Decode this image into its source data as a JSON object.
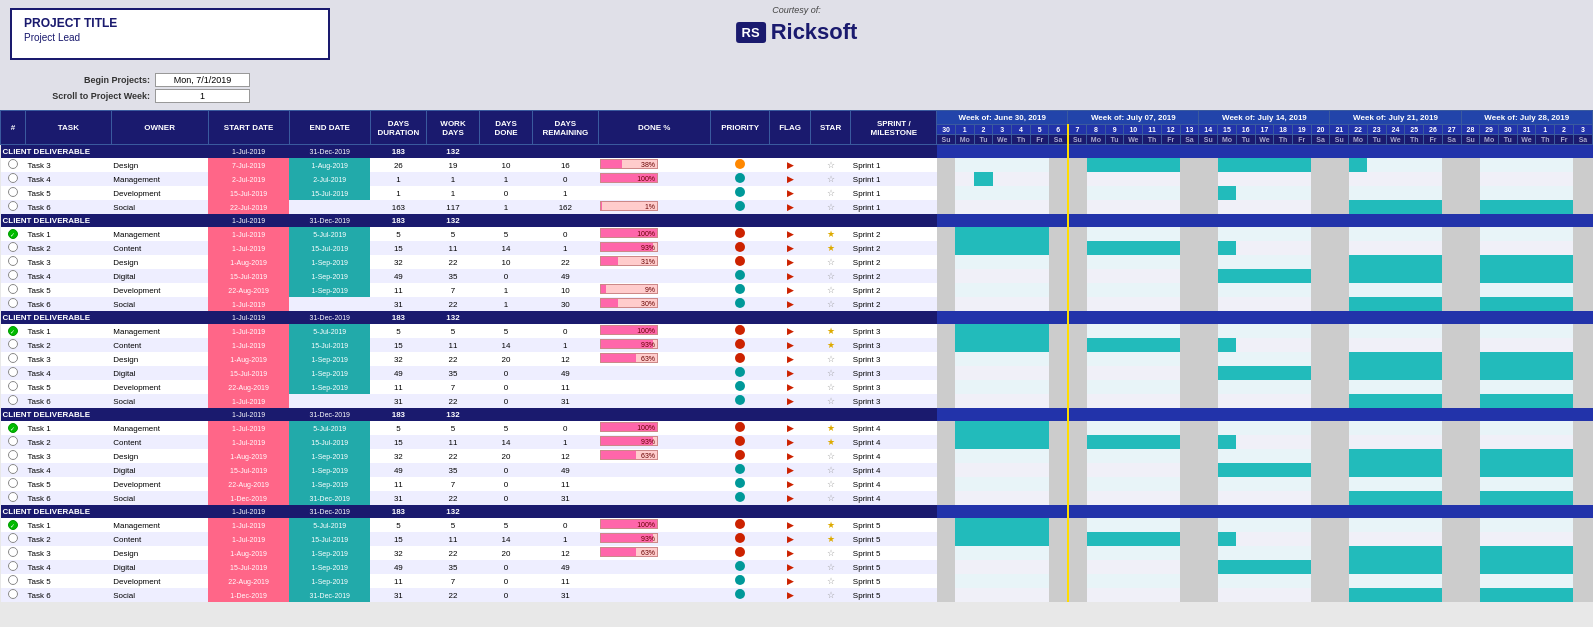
{
  "header": {
    "project_title": "PROJECT TITLE",
    "project_lead": "Project Lead",
    "courtesy_label": "Courtesy of:",
    "rs_logo": "RS",
    "company_name": "Ricksoft"
  },
  "controls": {
    "begin_label": "Begin Projects:",
    "begin_value": "Mon, 7/1/2019",
    "scroll_label": "Scroll to Project Week:",
    "scroll_value": "1"
  },
  "columns": {
    "status": "#",
    "task": "TASK",
    "owner": "OWNER",
    "start": "START DATE",
    "end": "END DATE",
    "duration": "DAYS DURATION",
    "work_days": "WORK DAYS",
    "days_done": "DAYS DONE",
    "days_remain": "DAYS REMAINING",
    "done_pct": "DONE %",
    "priority": "PRIORITY",
    "flag": "FLAG",
    "star": "STAR",
    "sprint": "SPRINT / MILESTONE"
  },
  "weeks": [
    "Week of: June 30, 2019",
    "Week of: July 07, 2019",
    "Week of: July 14, 2019",
    "Week of: July 21, 2019",
    "Week of: July 28, 2019"
  ],
  "sprints": [
    {
      "deliverable": {
        "start": "1-Jul-2019",
        "end": "31-Dec-2019",
        "duration": 183,
        "work_days": 132
      },
      "tasks": [
        {
          "status": "empty",
          "name": "Task 3",
          "owner": "Design",
          "start": "7-Jul-2019",
          "end": "1-Aug-2019",
          "dur": 26,
          "work": 19,
          "done": 10,
          "remain": 16,
          "pct": 38,
          "priority": "orange",
          "flag": true,
          "star": false,
          "sprint": "Sprint 1"
        },
        {
          "status": "empty",
          "name": "Task 4",
          "owner": "Management",
          "start": "2-Jul-2019",
          "end": "2-Jul-2019",
          "dur": 1,
          "work": 1,
          "done": 1,
          "remain": 0,
          "pct": 100,
          "priority": "teal",
          "flag": true,
          "star": false,
          "sprint": "Sprint 1"
        },
        {
          "status": "empty",
          "name": "Task 5",
          "owner": "Development",
          "start": "15-Jul-2019",
          "end": "15-Jul-2019",
          "dur": 1,
          "work": 1,
          "done": 0,
          "remain": 1,
          "pct": 0,
          "priority": "teal",
          "flag": true,
          "star": false,
          "sprint": "Sprint 1"
        },
        {
          "status": "empty",
          "name": "Task 6",
          "owner": "Social",
          "start": "22-Jul-2019",
          "end": "",
          "dur": 163,
          "work": 117,
          "done": 1,
          "remain": 162,
          "pct": 1,
          "priority": "teal",
          "flag": true,
          "star": false,
          "sprint": "Sprint 1"
        }
      ]
    },
    {
      "deliverable": {
        "start": "1-Jul-2019",
        "end": "31-Dec-2019",
        "duration": 183,
        "work_days": 132
      },
      "tasks": [
        {
          "status": "green",
          "name": "Task 1",
          "owner": "Management",
          "start": "1-Jul-2019",
          "end": "5-Jul-2019",
          "dur": 5,
          "work": 5,
          "done": 5,
          "remain": 0,
          "pct": 100,
          "priority": "red",
          "flag": true,
          "star": true,
          "sprint": "Sprint 2"
        },
        {
          "status": "empty",
          "name": "Task 2",
          "owner": "Content",
          "start": "1-Jul-2019",
          "end": "15-Jul-2019",
          "dur": 15,
          "work": 11,
          "done": 14,
          "remain": 1,
          "pct": 93,
          "priority": "red",
          "flag": true,
          "star": true,
          "sprint": "Sprint 2"
        },
        {
          "status": "empty",
          "name": "Task 3",
          "owner": "Design",
          "start": "1-Aug-2019",
          "end": "1-Sep-2019",
          "dur": 32,
          "work": 22,
          "done": 10,
          "remain": 22,
          "pct": 31,
          "priority": "red",
          "flag": true,
          "star": false,
          "sprint": "Sprint 2"
        },
        {
          "status": "empty",
          "name": "Task 4",
          "owner": "Digital",
          "start": "15-Jul-2019",
          "end": "1-Sep-2019",
          "dur": 49,
          "work": 35,
          "done": 0,
          "remain": 49,
          "pct": 0,
          "priority": "teal",
          "flag": true,
          "star": false,
          "sprint": "Sprint 2"
        },
        {
          "status": "empty",
          "name": "Task 5",
          "owner": "Development",
          "start": "22-Aug-2019",
          "end": "1-Sep-2019",
          "dur": 11,
          "work": 7,
          "done": 1,
          "remain": 10,
          "pct": 9,
          "priority": "teal",
          "flag": true,
          "star": false,
          "sprint": "Sprint 2"
        },
        {
          "status": "empty",
          "name": "Task 6",
          "owner": "Social",
          "start": "1-Jul-2019",
          "end": "",
          "dur": 31,
          "work": 22,
          "done": 1,
          "remain": 30,
          "pct": 30,
          "priority": "teal",
          "flag": true,
          "star": false,
          "sprint": "Sprint 2"
        }
      ]
    },
    {
      "deliverable": {
        "start": "1-Jul-2019",
        "end": "31-Dec-2019",
        "duration": 183,
        "work_days": 132
      },
      "tasks": [
        {
          "status": "green",
          "name": "Task 1",
          "owner": "Management",
          "start": "1-Jul-2019",
          "end": "5-Jul-2019",
          "dur": 5,
          "work": 5,
          "done": 5,
          "remain": 0,
          "pct": 100,
          "priority": "red",
          "flag": true,
          "star": true,
          "sprint": "Sprint 3"
        },
        {
          "status": "empty",
          "name": "Task 2",
          "owner": "Content",
          "start": "1-Jul-2019",
          "end": "15-Jul-2019",
          "dur": 15,
          "work": 11,
          "done": 14,
          "remain": 1,
          "pct": 93,
          "priority": "red",
          "flag": true,
          "star": true,
          "sprint": "Sprint 3"
        },
        {
          "status": "empty",
          "name": "Task 3",
          "owner": "Design",
          "start": "1-Aug-2019",
          "end": "1-Sep-2019",
          "dur": 32,
          "work": 22,
          "done": 20,
          "remain": 12,
          "pct": 63,
          "priority": "red",
          "flag": true,
          "star": false,
          "sprint": "Sprint 3"
        },
        {
          "status": "empty",
          "name": "Task 4",
          "owner": "Digital",
          "start": "15-Jul-2019",
          "end": "1-Sep-2019",
          "dur": 49,
          "work": 35,
          "done": 0,
          "remain": 49,
          "pct": 0,
          "priority": "teal",
          "flag": true,
          "star": false,
          "sprint": "Sprint 3"
        },
        {
          "status": "empty",
          "name": "Task 5",
          "owner": "Development",
          "start": "22-Aug-2019",
          "end": "1-Sep-2019",
          "dur": 11,
          "work": 7,
          "done": 0,
          "remain": 11,
          "pct": 0,
          "priority": "teal",
          "flag": true,
          "star": false,
          "sprint": "Sprint 3"
        },
        {
          "status": "empty",
          "name": "Task 6",
          "owner": "Social",
          "start": "1-Jul-2019",
          "end": "",
          "dur": 31,
          "work": 22,
          "done": 0,
          "remain": 31,
          "pct": 0,
          "priority": "teal",
          "flag": true,
          "star": false,
          "sprint": "Sprint 3"
        }
      ]
    },
    {
      "deliverable": {
        "start": "1-Jul-2019",
        "end": "31-Dec-2019",
        "duration": 183,
        "work_days": 132
      },
      "tasks": [
        {
          "status": "green",
          "name": "Task 1",
          "owner": "Management",
          "start": "1-Jul-2019",
          "end": "5-Jul-2019",
          "dur": 5,
          "work": 5,
          "done": 5,
          "remain": 0,
          "pct": 100,
          "priority": "red",
          "flag": true,
          "star": true,
          "sprint": "Sprint 4"
        },
        {
          "status": "empty",
          "name": "Task 2",
          "owner": "Content",
          "start": "1-Jul-2019",
          "end": "15-Jul-2019",
          "dur": 15,
          "work": 11,
          "done": 14,
          "remain": 1,
          "pct": 93,
          "priority": "red",
          "flag": true,
          "star": true,
          "sprint": "Sprint 4"
        },
        {
          "status": "empty",
          "name": "Task 3",
          "owner": "Design",
          "start": "1-Aug-2019",
          "end": "1-Sep-2019",
          "dur": 32,
          "work": 22,
          "done": 20,
          "remain": 12,
          "pct": 63,
          "priority": "red",
          "flag": true,
          "star": false,
          "sprint": "Sprint 4"
        },
        {
          "status": "empty",
          "name": "Task 4",
          "owner": "Digital",
          "start": "15-Jul-2019",
          "end": "1-Sep-2019",
          "dur": 49,
          "work": 35,
          "done": 0,
          "remain": 49,
          "pct": 0,
          "priority": "teal",
          "flag": true,
          "star": false,
          "sprint": "Sprint 4"
        },
        {
          "status": "empty",
          "name": "Task 5",
          "owner": "Development",
          "start": "22-Aug-2019",
          "end": "1-Sep-2019",
          "dur": 11,
          "work": 7,
          "done": 0,
          "remain": 11,
          "pct": 0,
          "priority": "teal",
          "flag": true,
          "star": false,
          "sprint": "Sprint 4"
        },
        {
          "status": "empty",
          "name": "Task 6",
          "owner": "Social",
          "start": "1-Dec-2019",
          "end": "31-Dec-2019",
          "dur": 31,
          "work": 22,
          "done": 0,
          "remain": 31,
          "pct": 0,
          "priority": "teal",
          "flag": true,
          "star": false,
          "sprint": "Sprint 4"
        }
      ]
    },
    {
      "deliverable": {
        "start": "1-Jul-2019",
        "end": "31-Dec-2019",
        "duration": 183,
        "work_days": 132
      },
      "tasks": [
        {
          "status": "green",
          "name": "Task 1",
          "owner": "Management",
          "start": "1-Jul-2019",
          "end": "5-Jul-2019",
          "dur": 5,
          "work": 5,
          "done": 5,
          "remain": 0,
          "pct": 100,
          "priority": "red",
          "flag": true,
          "star": true,
          "sprint": "Sprint 5"
        },
        {
          "status": "empty",
          "name": "Task 2",
          "owner": "Content",
          "start": "1-Jul-2019",
          "end": "15-Jul-2019",
          "dur": 15,
          "work": 11,
          "done": 14,
          "remain": 1,
          "pct": 93,
          "priority": "red",
          "flag": true,
          "star": true,
          "sprint": "Sprint 5"
        },
        {
          "status": "empty",
          "name": "Task 3",
          "owner": "Design",
          "start": "1-Aug-2019",
          "end": "1-Sep-2019",
          "dur": 32,
          "work": 22,
          "done": 20,
          "remain": 12,
          "pct": 63,
          "priority": "red",
          "flag": true,
          "star": false,
          "sprint": "Sprint 5"
        },
        {
          "status": "empty",
          "name": "Task 4",
          "owner": "Digital",
          "start": "15-Jul-2019",
          "end": "1-Sep-2019",
          "dur": 49,
          "work": 35,
          "done": 0,
          "remain": 49,
          "pct": 0,
          "priority": "teal",
          "flag": true,
          "star": false,
          "sprint": "Sprint 5"
        },
        {
          "status": "empty",
          "name": "Task 5",
          "owner": "Development",
          "start": "22-Aug-2019",
          "end": "1-Sep-2019",
          "dur": 11,
          "work": 7,
          "done": 0,
          "remain": 11,
          "pct": 0,
          "priority": "teal",
          "flag": true,
          "star": false,
          "sprint": "Sprint 5"
        },
        {
          "status": "empty",
          "name": "Task 6",
          "owner": "Social",
          "start": "1-Dec-2019",
          "end": "31-Dec-2019",
          "dur": 31,
          "work": 22,
          "done": 0,
          "remain": 31,
          "pct": 0,
          "priority": "teal",
          "flag": true,
          "star": false,
          "sprint": "Sprint 5"
        }
      ]
    }
  ]
}
